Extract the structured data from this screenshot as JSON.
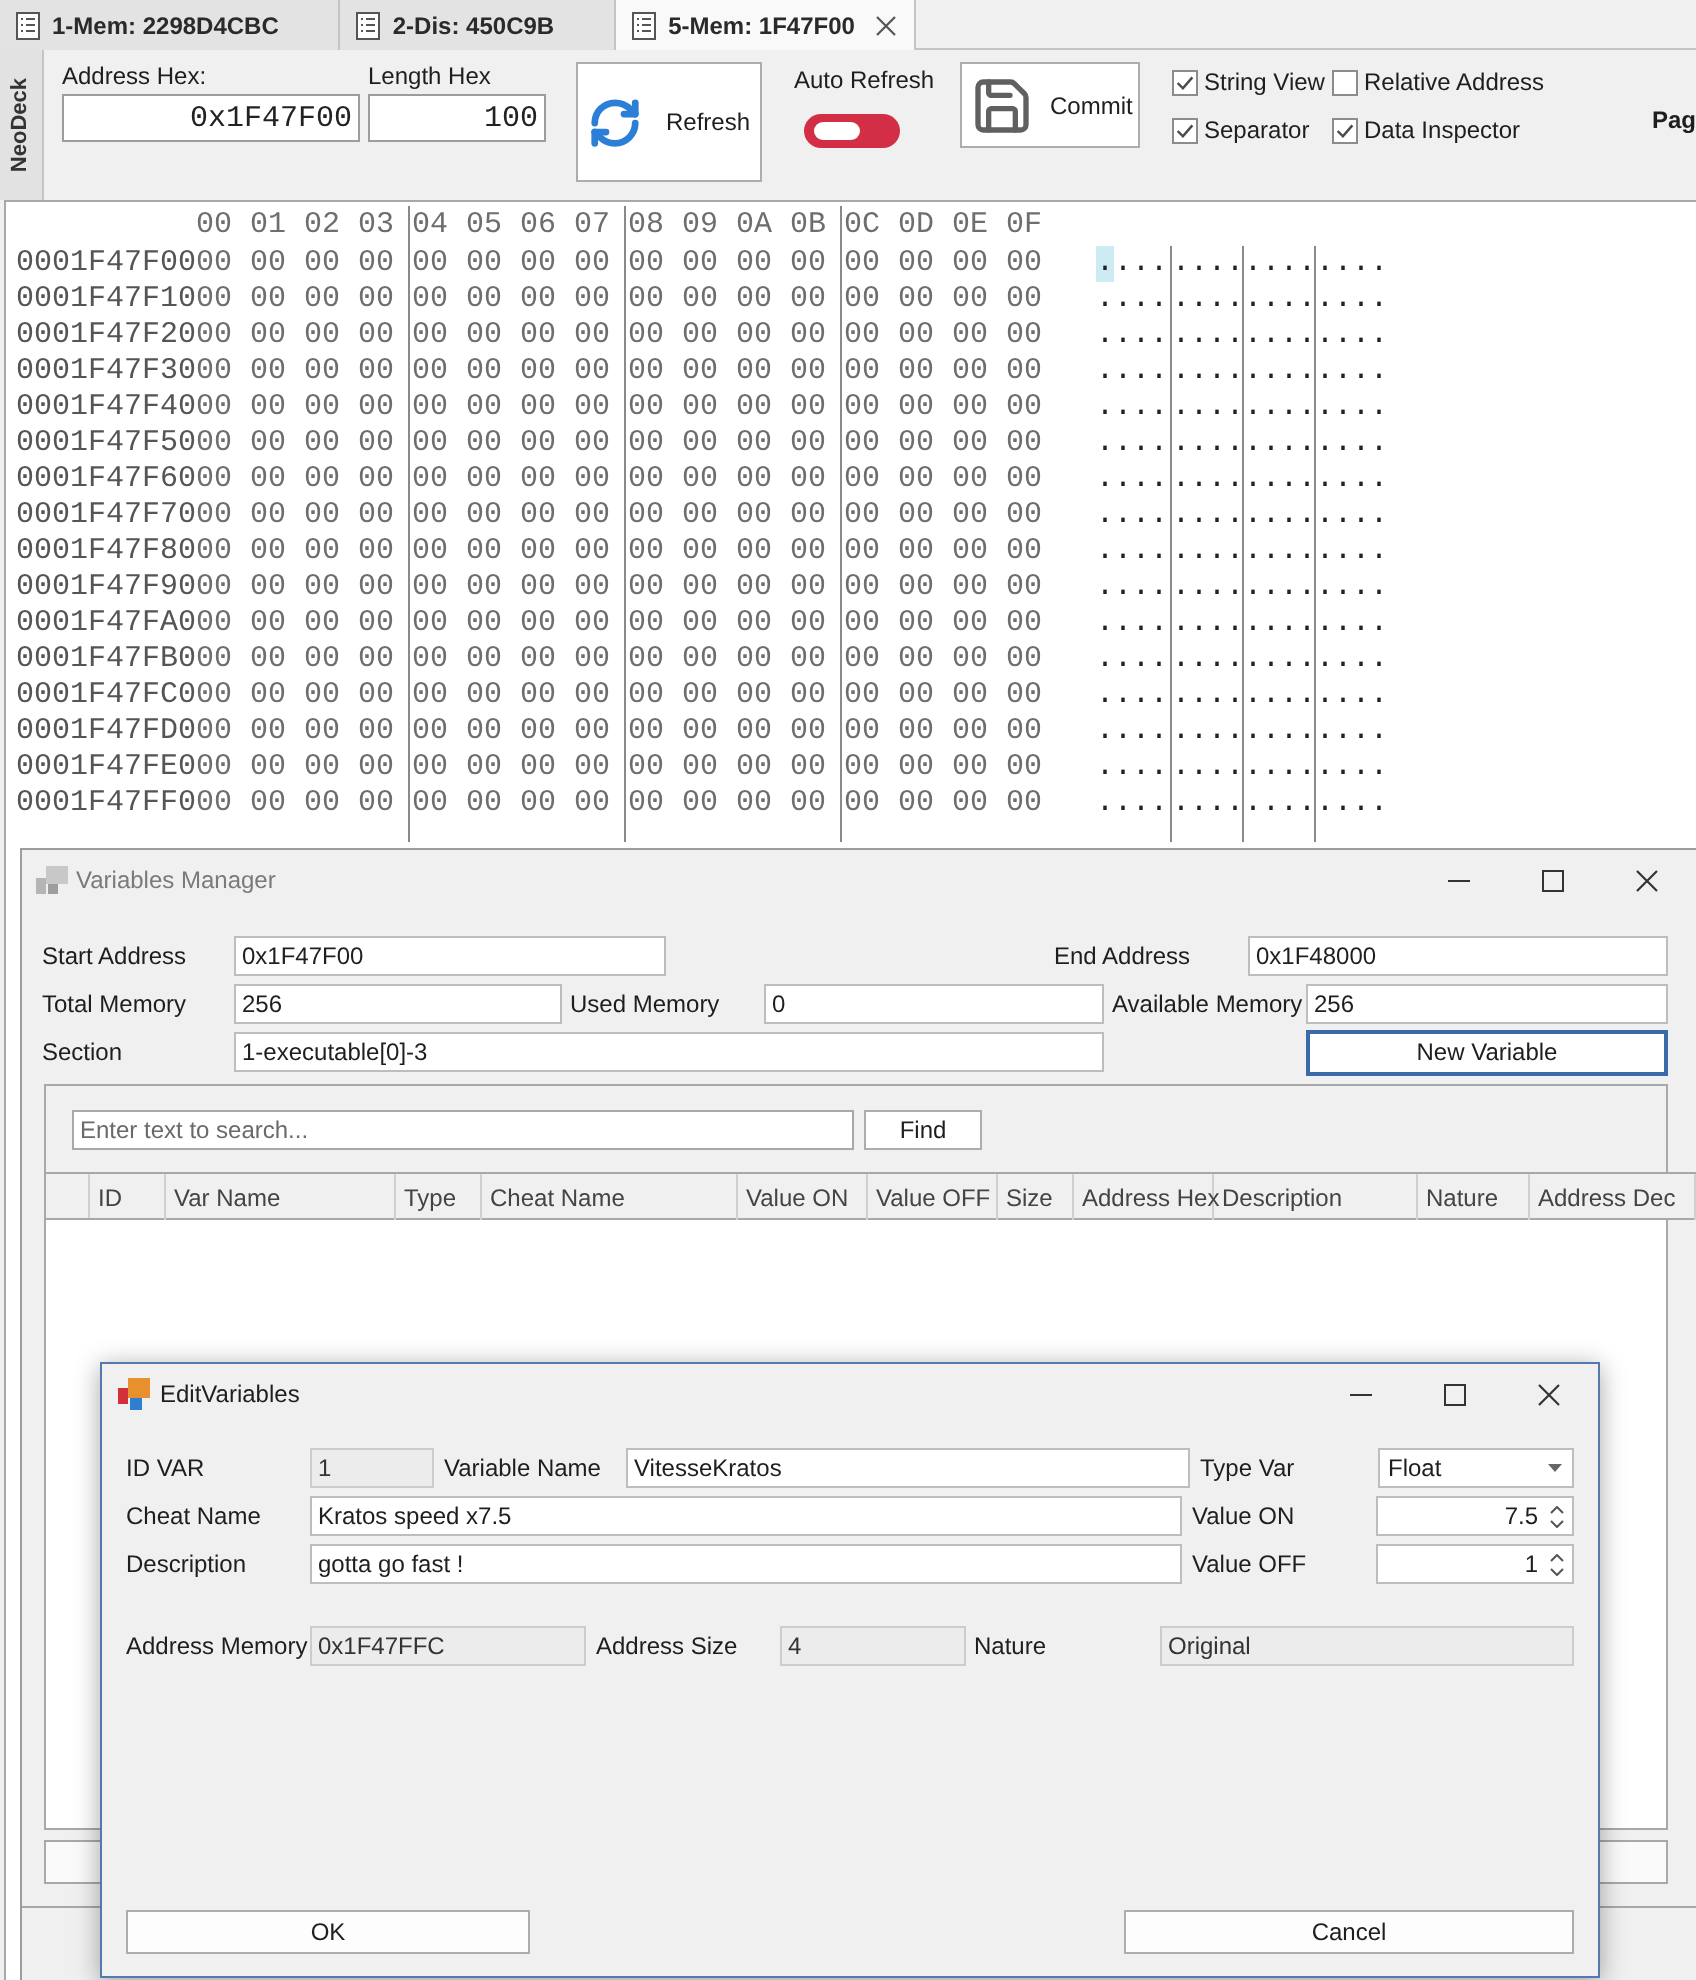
{
  "tabs": [
    {
      "label": "1-Mem: 2298D4CBC",
      "selected": false
    },
    {
      "label": "2-Dis: 450C9B",
      "selected": false
    },
    {
      "label": "5-Mem: 1F47F00",
      "selected": true
    }
  ],
  "toolbar": {
    "side_label": "NeoDeck",
    "address": {
      "label": "Address Hex:",
      "value": "0x1F47F00"
    },
    "length": {
      "label": "Length Hex",
      "value": "100"
    },
    "refresh_button": "Refresh",
    "auto_refresh": {
      "label": "Auto Refresh",
      "on": false
    },
    "commit_button": "Commit",
    "options": [
      {
        "label": "String View",
        "checked": true
      },
      {
        "label": "Relative Address",
        "checked": false
      },
      {
        "label": "Separator",
        "checked": true
      },
      {
        "label": "Data Inspector",
        "checked": true
      }
    ],
    "truncated_label": "Pag"
  },
  "hex_view": {
    "header": [
      "00 01 02 03",
      "04 05 06 07",
      "08 09 0A 0B",
      "0C 0D 0E 0F"
    ],
    "rows": [
      {
        "address": "0001F47F00",
        "bytes": [
          "00 00 00 00",
          "00 00 00 00",
          "00 00 00 00",
          "00 00 00 00"
        ],
        "ascii": [
          "....",
          "....",
          "....",
          "...."
        ],
        "caret": true
      },
      {
        "address": "0001F47F10",
        "bytes": [
          "00 00 00 00",
          "00 00 00 00",
          "00 00 00 00",
          "00 00 00 00"
        ],
        "ascii": [
          "....",
          "....",
          "....",
          "...."
        ],
        "caret": false
      },
      {
        "address": "0001F47F20",
        "bytes": [
          "00 00 00 00",
          "00 00 00 00",
          "00 00 00 00",
          "00 00 00 00"
        ],
        "ascii": [
          "....",
          "....",
          "....",
          "...."
        ],
        "caret": false
      },
      {
        "address": "0001F47F30",
        "bytes": [
          "00 00 00 00",
          "00 00 00 00",
          "00 00 00 00",
          "00 00 00 00"
        ],
        "ascii": [
          "....",
          "....",
          "....",
          "...."
        ],
        "caret": false
      },
      {
        "address": "0001F47F40",
        "bytes": [
          "00 00 00 00",
          "00 00 00 00",
          "00 00 00 00",
          "00 00 00 00"
        ],
        "ascii": [
          "....",
          "....",
          "....",
          "...."
        ],
        "caret": false
      },
      {
        "address": "0001F47F50",
        "bytes": [
          "00 00 00 00",
          "00 00 00 00",
          "00 00 00 00",
          "00 00 00 00"
        ],
        "ascii": [
          "....",
          "....",
          "....",
          "...."
        ],
        "caret": false
      },
      {
        "address": "0001F47F60",
        "bytes": [
          "00 00 00 00",
          "00 00 00 00",
          "00 00 00 00",
          "00 00 00 00"
        ],
        "ascii": [
          "....",
          "....",
          "....",
          "...."
        ],
        "caret": false
      },
      {
        "address": "0001F47F70",
        "bytes": [
          "00 00 00 00",
          "00 00 00 00",
          "00 00 00 00",
          "00 00 00 00"
        ],
        "ascii": [
          "....",
          "....",
          "....",
          "...."
        ],
        "caret": false
      },
      {
        "address": "0001F47F80",
        "bytes": [
          "00 00 00 00",
          "00 00 00 00",
          "00 00 00 00",
          "00 00 00 00"
        ],
        "ascii": [
          "....",
          "....",
          "....",
          "...."
        ],
        "caret": false
      },
      {
        "address": "0001F47F90",
        "bytes": [
          "00 00 00 00",
          "00 00 00 00",
          "00 00 00 00",
          "00 00 00 00"
        ],
        "ascii": [
          "....",
          "....",
          "....",
          "...."
        ],
        "caret": false
      },
      {
        "address": "0001F47FA0",
        "bytes": [
          "00 00 00 00",
          "00 00 00 00",
          "00 00 00 00",
          "00 00 00 00"
        ],
        "ascii": [
          "....",
          "....",
          "....",
          "...."
        ],
        "caret": false
      },
      {
        "address": "0001F47FB0",
        "bytes": [
          "00 00 00 00",
          "00 00 00 00",
          "00 00 00 00",
          "00 00 00 00"
        ],
        "ascii": [
          "....",
          "....",
          "....",
          "...."
        ],
        "caret": false
      },
      {
        "address": "0001F47FC0",
        "bytes": [
          "00 00 00 00",
          "00 00 00 00",
          "00 00 00 00",
          "00 00 00 00"
        ],
        "ascii": [
          "....",
          "....",
          "....",
          "...."
        ],
        "caret": false
      },
      {
        "address": "0001F47FD0",
        "bytes": [
          "00 00 00 00",
          "00 00 00 00",
          "00 00 00 00",
          "00 00 00 00"
        ],
        "ascii": [
          "....",
          "....",
          "....",
          "...."
        ],
        "caret": false
      },
      {
        "address": "0001F47FE0",
        "bytes": [
          "00 00 00 00",
          "00 00 00 00",
          "00 00 00 00",
          "00 00 00 00"
        ],
        "ascii": [
          "....",
          "....",
          "....",
          "...."
        ],
        "caret": false
      },
      {
        "address": "0001F47FF0",
        "bytes": [
          "00 00 00 00",
          "00 00 00 00",
          "00 00 00 00",
          "00 00 00 00"
        ],
        "ascii": [
          "....",
          "....",
          "....",
          "...."
        ],
        "caret": false
      }
    ]
  },
  "variables_manager": {
    "title": "Variables Manager",
    "start_address": {
      "label": "Start Address",
      "value": "0x1F47F00"
    },
    "end_address": {
      "label": "End Address",
      "value": "0x1F48000"
    },
    "total_memory": {
      "label": "Total Memory",
      "value": "256"
    },
    "used_memory": {
      "label": "Used Memory",
      "value": "0"
    },
    "available_memory": {
      "label": "Available Memory",
      "value": "256"
    },
    "section": {
      "label": "Section",
      "value": "1-executable[0]-3"
    },
    "new_variable_button": {
      "label": "New Variable",
      "focused": true
    },
    "search": {
      "placeholder": "Enter text to search..."
    },
    "find_button": "Find",
    "columns": [
      "ID",
      "Var Name",
      "Type",
      "Cheat Name",
      "Value ON",
      "Value OFF",
      "Size",
      "Address Hex",
      "Description",
      "Nature",
      "Address Dec"
    ]
  },
  "edit_variables": {
    "title": "EditVariables",
    "id_var": {
      "label": "ID VAR",
      "value": "1",
      "readonly": true
    },
    "variable_name": {
      "label": "Variable Name",
      "value": "VitesseKratos",
      "readonly": false
    },
    "type_var": {
      "label": "Type Var",
      "value": "Float"
    },
    "cheat_name": {
      "label": "Cheat Name",
      "value": "Kratos speed x7.5",
      "readonly": false
    },
    "value_on": {
      "label": "Value ON",
      "value": "7.5"
    },
    "description": {
      "label": "Description",
      "value": "gotta go fast !",
      "readonly": false
    },
    "value_off": {
      "label": "Value OFF",
      "value": "1"
    },
    "address_memory": {
      "label": "Address Memory",
      "value": "0x1F47FFC",
      "readonly": true
    },
    "address_size": {
      "label": "Address Size",
      "value": "4",
      "readonly": true
    },
    "nature": {
      "label": "Nature",
      "value": "Original",
      "readonly": true
    },
    "ok_button": "OK",
    "cancel_button": "Cancel"
  }
}
